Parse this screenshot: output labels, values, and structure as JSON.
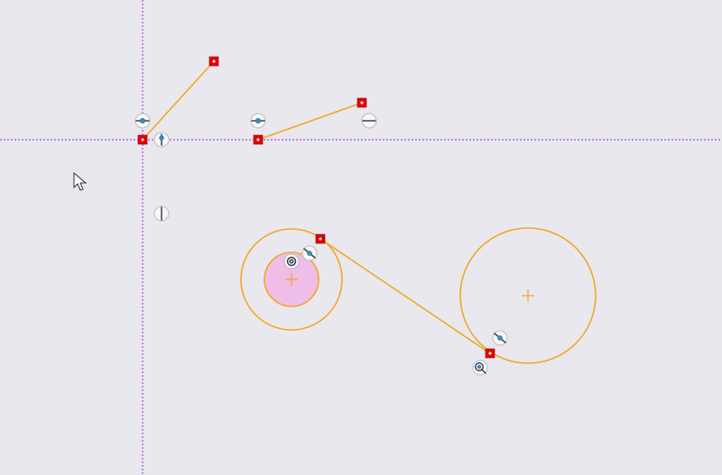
{
  "app": {
    "view": "2D sketch"
  },
  "sketch": {
    "axes": {
      "horizontal_color": "#a950d6",
      "vertical_color": "#a950d6"
    },
    "colors": {
      "geometry": "#f5a623",
      "endpoint": "#e40000",
      "selected_fill": "#eebde8",
      "background": "#e8e8ee"
    },
    "constraint_icons": [
      "coincident-icon",
      "horizontal-icon",
      "tangent-icon",
      "vertical-icon",
      "concentric-icon",
      "pierce-icon"
    ]
  }
}
